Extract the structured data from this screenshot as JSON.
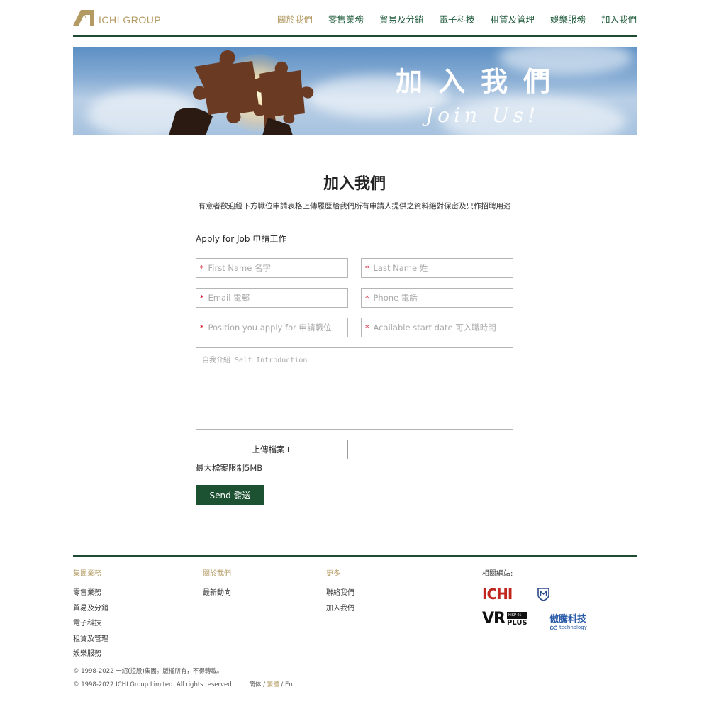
{
  "header": {
    "logo_text": "ICHI GROUP",
    "nav": [
      {
        "label": "關於我們",
        "active": true
      },
      {
        "label": "零售業務",
        "active": false
      },
      {
        "label": "貿易及分銷",
        "active": false
      },
      {
        "label": "電子科技",
        "active": false
      },
      {
        "label": "租賃及管理",
        "active": false
      },
      {
        "label": "娛樂服務",
        "active": false
      },
      {
        "label": "加入我們",
        "active": false
      }
    ]
  },
  "banner": {
    "title": "加入我們",
    "subtitle": "Join Us!"
  },
  "main": {
    "title": "加入我們",
    "description": "有意者歡迎經下方職位申請表格上傳履歷給我們所有申請人提供之資料絕對保密及只作招聘用途",
    "form_heading": "Apply for Job 申請工作",
    "fields": {
      "first_name": "First Name 名字",
      "last_name": "Last Name 姓",
      "email": "Email 電郵",
      "phone": "Phone 電話",
      "position": "Position you apply for 申請職位",
      "start_date": "Acailable start date 可入職時間"
    },
    "required_mark": "*",
    "intro_placeholder": "自我介紹 Self Introduction",
    "upload_label": "上傳檔案+",
    "upload_note": "最大檔案限制5MB",
    "send_label": "Send 發送"
  },
  "footer": {
    "col1": {
      "title": "集團業務",
      "items": [
        "零售業務",
        "貿易及分銷",
        "電子科技",
        "租賃及管理",
        "娛樂服務"
      ]
    },
    "col2": {
      "title": "關於我們",
      "items": [
        "最新動向"
      ]
    },
    "col3": {
      "title": "更多",
      "items": [
        "聯絡我們",
        "加入我們"
      ]
    },
    "col4": {
      "title": "相關網站:"
    },
    "sites": {
      "ichi": "ICHI",
      "vr_big": "VR",
      "vr_tag": "KIKP 01",
      "vr_plus": "PLUS",
      "tech_cn": "傲騰科技",
      "tech_en": "technology"
    },
    "copyright_cn": "© 1998-2022 一紹(控股)集團。版權所有，不得轉載。",
    "copyright_en": "© 1998-2022 ICHI Group Limited. All rights reserved",
    "lang": {
      "simplified": "簡体",
      "traditional": "繁體",
      "english": "En",
      "sep": " / "
    }
  },
  "colors": {
    "brand_green": "#1c5132",
    "brand_gold": "#b39a62",
    "required_red": "#d0021b"
  }
}
